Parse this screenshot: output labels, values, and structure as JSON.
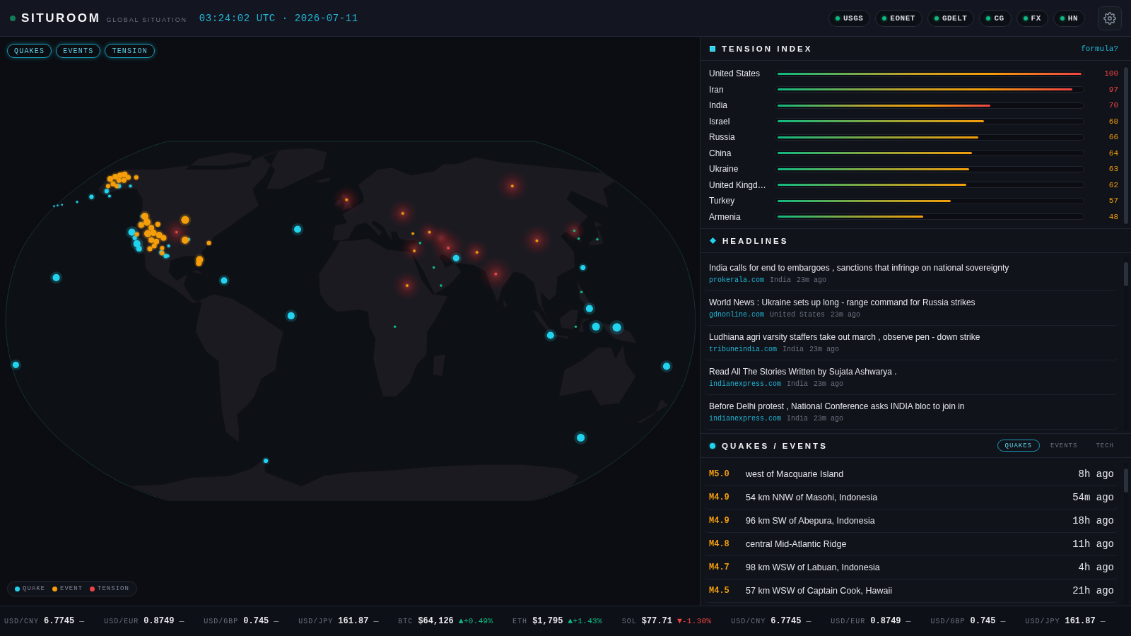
{
  "header": {
    "title": "SITUROOM",
    "subtitle": "GLOBAL SITUATION",
    "clock": "03:24:02 UTC · 2026-07-11"
  },
  "feeds": [
    {
      "label": "USGS",
      "online": true
    },
    {
      "label": "EONET",
      "online": true
    },
    {
      "label": "GDELT",
      "online": true
    },
    {
      "label": "CG",
      "online": true
    },
    {
      "label": "FX",
      "online": true
    },
    {
      "label": "HN",
      "online": true
    }
  ],
  "map": {
    "layers": [
      {
        "label": "QUAKES",
        "on": true
      },
      {
        "label": "EVENTS",
        "on": true
      },
      {
        "label": "TENSION",
        "on": true
      }
    ],
    "legend": [
      {
        "label": "QUAKE",
        "color": "#22d3ee"
      },
      {
        "label": "EVENT",
        "color": "#f59e0b"
      },
      {
        "label": "TENSION",
        "color": "#ef4444"
      }
    ]
  },
  "tension_index": {
    "title": "TENSION INDEX",
    "link": "formula?",
    "rows": [
      {
        "country": "United States",
        "score": "100",
        "level": 1
      },
      {
        "country": "Iran",
        "score": "97",
        "level": 0.97
      },
      {
        "country": "India",
        "score": "70",
        "level": 0.7
      },
      {
        "country": "Israel",
        "score": "68",
        "level": 0.68
      },
      {
        "country": "Russia",
        "score": "66",
        "level": 0.66
      },
      {
        "country": "China",
        "score": "64",
        "level": 0.64
      },
      {
        "country": "Ukraine",
        "score": "63",
        "level": 0.63
      },
      {
        "country": "United Kingd…",
        "score": "62",
        "level": 0.62
      },
      {
        "country": "Turkey",
        "score": "57",
        "level": 0.57
      },
      {
        "country": "Armenia",
        "score": "48",
        "level": 0.48
      }
    ]
  },
  "headlines": {
    "title": "HEADLINES",
    "items": [
      {
        "title": "India calls for end to embargoes , sanctions that infringe on national sovereignty",
        "source": "prokerala.com",
        "country": "India",
        "time": "23m ago"
      },
      {
        "title": "World News : Ukraine sets up long - range command for Russia strikes",
        "source": "gdnonline.com",
        "country": "United States",
        "time": "23m ago"
      },
      {
        "title": "Ludhiana agri varsity staffers take out march , observe pen - down strike",
        "source": "tribuneindia.com",
        "country": "India",
        "time": "23m ago"
      },
      {
        "title": "Read All The Stories Written by Sujata Ashwarya .",
        "source": "indianexpress.com",
        "country": "India",
        "time": "23m ago"
      },
      {
        "title": "Before Delhi protest , National Conference asks INDIA bloc to join in",
        "source": "indianexpress.com",
        "country": "India",
        "time": "23m ago"
      }
    ]
  },
  "quakes_events": {
    "title": "QUAKES / EVENTS",
    "tabs": [
      {
        "label": "QUAKES",
        "selected": true
      },
      {
        "label": "EVENTS",
        "selected": false
      },
      {
        "label": "TECH",
        "selected": false
      }
    ],
    "rows": [
      {
        "magnitude": "M5.0",
        "place": "west of Macquarie Island",
        "time": "8h ago"
      },
      {
        "magnitude": "M4.9",
        "place": "54 km NNW of Masohi, Indonesia",
        "time": "54m ago"
      },
      {
        "magnitude": "M4.9",
        "place": "96 km SW of Abepura, Indonesia",
        "time": "18h ago"
      },
      {
        "magnitude": "M4.8",
        "place": "central Mid-Atlantic Ridge",
        "time": "11h ago"
      },
      {
        "magnitude": "M4.7",
        "place": "98 km WSW of Labuan, Indonesia",
        "time": "4h ago"
      },
      {
        "magnitude": "M4.5",
        "place": "57 km WSW of Captain Cook, Hawaii",
        "time": "21h ago"
      }
    ]
  },
  "ticker": [
    {
      "label": "USD/CNY",
      "value": "6.7745",
      "change": "—",
      "kind": "flat"
    },
    {
      "label": "USD/EUR",
      "value": "0.8749",
      "change": "—",
      "kind": "flat"
    },
    {
      "label": "USD/GBP",
      "value": "0.745",
      "change": "—",
      "kind": "flat"
    },
    {
      "label": "USD/JPY",
      "value": "161.87",
      "change": "—",
      "kind": "flat"
    },
    {
      "label": "BTC",
      "value": "$64,126",
      "change": "▲+0.49%",
      "kind": "up"
    },
    {
      "label": "ETH",
      "value": "$1,795",
      "change": "▲+1.43%",
      "kind": "up"
    },
    {
      "label": "SOL",
      "value": "$77.71",
      "change": "▼-1.30%",
      "kind": "down"
    },
    {
      "label": "USD/CNY",
      "value": "6.7745",
      "change": "—",
      "kind": "flat"
    },
    {
      "label": "USD/EUR",
      "value": "0.8749",
      "change": "—",
      "kind": "flat"
    },
    {
      "label": "USD/GBP",
      "value": "0.745",
      "change": "—",
      "kind": "flat"
    },
    {
      "label": "USD/JPY",
      "value": "161.87",
      "change": "—",
      "kind": "flat"
    }
  ]
}
